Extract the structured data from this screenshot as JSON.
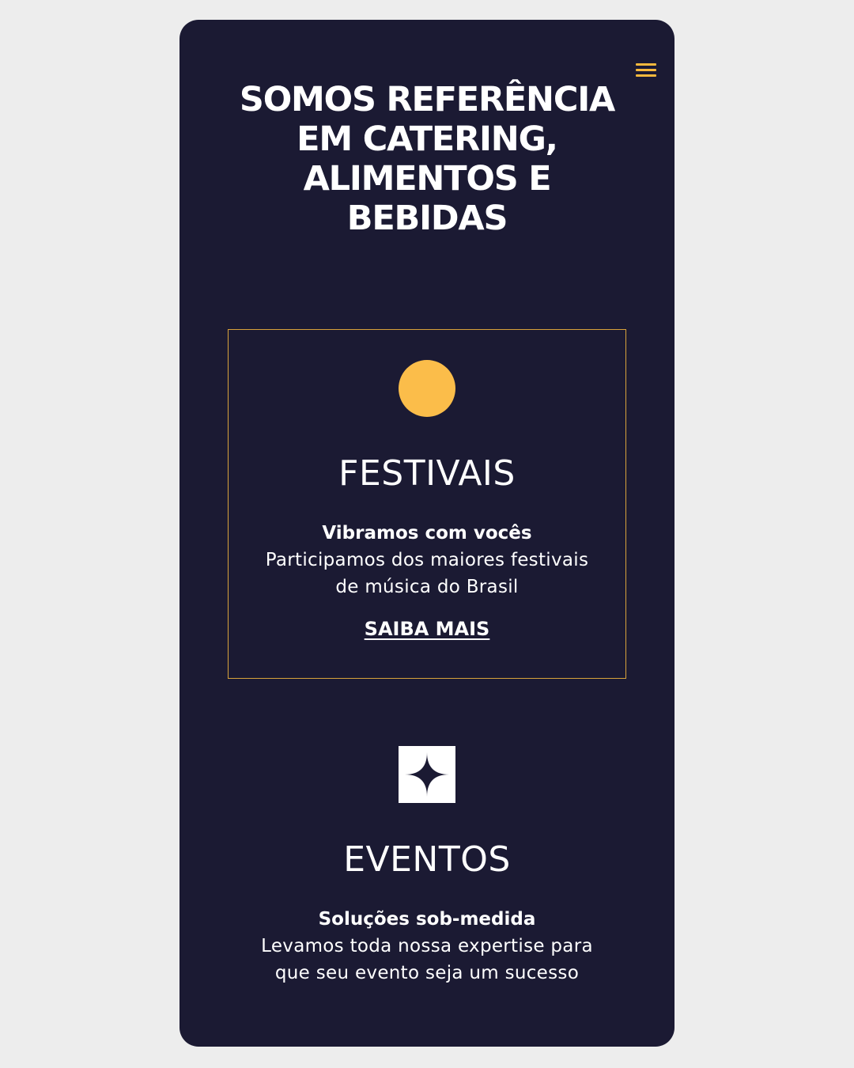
{
  "colors": {
    "page_background": "#ededed",
    "app_background": "#1b1a33",
    "accent": "#f6b83d",
    "card_border": "#d8a23b",
    "text": "#ffffff"
  },
  "header": {
    "menu_icon": "hamburger-menu-icon"
  },
  "hero": {
    "title": "SOMOS REFERÊNCIA\nEM CATERING,\nALIMENTOS E\nBEBIDAS"
  },
  "sections": [
    {
      "icon": "circle-icon",
      "title": "FESTIVAIS",
      "subtitle": "Vibramos com vocês",
      "description": "Participamos dos maiores festivais\nde música do Brasil",
      "cta": "SAIBA MAIS"
    },
    {
      "icon": "sparkle-star-icon",
      "title": "EVENTOS",
      "subtitle": "Soluções sob-medida",
      "description": "Levamos toda nossa expertise para\nque seu evento seja um sucesso"
    }
  ]
}
